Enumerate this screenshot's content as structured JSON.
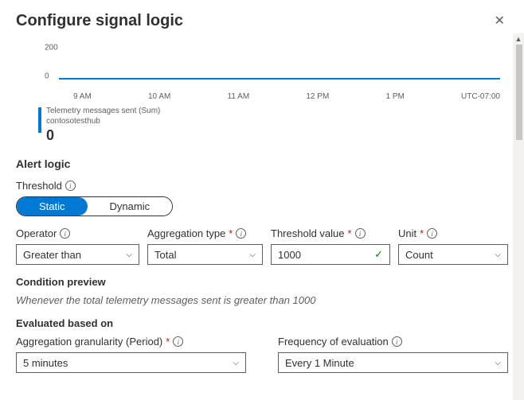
{
  "header": {
    "title": "Configure signal logic"
  },
  "chart_data": {
    "type": "line",
    "yticks": [
      "200",
      "0"
    ],
    "xticks": [
      "9 AM",
      "10 AM",
      "11 AM",
      "12 PM",
      "1 PM"
    ],
    "tz": "UTC-07:00",
    "series": [
      {
        "name": "Telemetry messages sent (Sum)",
        "resource": "contosotesthub",
        "value": "0"
      }
    ]
  },
  "alert": {
    "section": "Alert logic",
    "threshold_label": "Threshold",
    "toggle": {
      "static": "Static",
      "dynamic": "Dynamic"
    },
    "operator": {
      "label": "Operator",
      "value": "Greater than"
    },
    "aggregation": {
      "label": "Aggregation type",
      "value": "Total"
    },
    "threshold_value": {
      "label": "Threshold value",
      "value": "1000"
    },
    "unit": {
      "label": "Unit",
      "value": "Count"
    }
  },
  "preview": {
    "label": "Condition preview",
    "text": "Whenever the total telemetry messages sent is greater than 1000"
  },
  "evaluated": {
    "label": "Evaluated based on",
    "granularity": {
      "label": "Aggregation granularity (Period)",
      "value": "5 minutes"
    },
    "frequency": {
      "label": "Frequency of evaluation",
      "value": "Every 1 Minute"
    }
  }
}
